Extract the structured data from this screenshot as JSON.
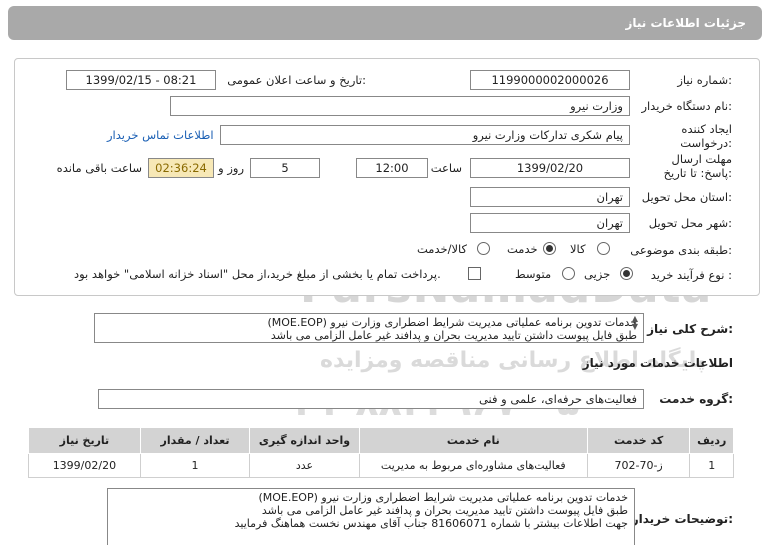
{
  "header": {
    "title": "جزئیات اطلاعات نیاز"
  },
  "form": {
    "need_number_label": "شماره نیاز:",
    "need_number": "1199000002000026",
    "announce_label": "تاریخ و ساعت اعلان عمومی:",
    "announce_value": "1399/02/15 - 08:21",
    "buyer_label": "نام دستگاه خریدار:",
    "buyer_value": "وزارت نیرو",
    "creator_label": "ایجاد کننده درخواست:",
    "creator_value": "پیام شکری تدارکات وزارت نیرو",
    "contact_link": "اطلاعات تماس خریدار",
    "deadline_label": "مهلت ارسال پاسخ: تا تاریخ:",
    "deadline_date": "1399/02/20",
    "time_label": "ساعت",
    "deadline_time": "12:00",
    "days_count": "5",
    "days_label": "روز و",
    "remaining_time": "02:36:24",
    "remaining_label": "ساعت باقی مانده",
    "province_label": "استان محل تحویل:",
    "province_value": "تهران",
    "city_label": "شهر محل تحویل:",
    "city_value": "تهران",
    "category_label": "طبقه بندی موضوعی:",
    "category_options": [
      "کالا",
      "خدمت",
      "کالا/خدمت"
    ],
    "category_selected": "خدمت",
    "process_label": "نوع فرآیند خرید :",
    "process_options": [
      "جزیی",
      "متوسط"
    ],
    "process_selected": "جزیی",
    "payment_note": "پرداخت تمام یا بخشی از مبلغ خرید،از محل \"اسناد خزانه اسلامی\" خواهد بود."
  },
  "summary": {
    "label": "شرح کلی نیاز:",
    "line1": "خدمات تدوین برنامه عملیاتی مدیریت شرایط اضطراری وزارت نیرو (MOE.EOP)",
    "line2": "طبق فایل پیوست داشتن تایید مدیریت بحران و پدافند غیر عامل الزامی می باشد"
  },
  "services": {
    "title": "اطلاعات خدمات مورد نیاز",
    "group_label": "گروه خدمت:",
    "group_value": "فعالیت‌های حرفه‌ای، علمی و فنی",
    "columns": [
      "ردیف",
      "کد خدمت",
      "نام خدمت",
      "واحد اندازه گیری",
      "تعداد / مقدار",
      "تاریخ نیاز"
    ],
    "rows": [
      [
        "1",
        "ز-70-702",
        "فعالیت‌های مشاوره‌ای مربوط به مدیریت",
        "عدد",
        "1",
        "1399/02/20"
      ]
    ]
  },
  "buyer_notes": {
    "label": "توضیحات خریدار:",
    "line1": "خدمات تدوین برنامه عملیاتی مدیریت شرایط اضطراری وزارت نیرو (MOE.EOP)",
    "line2": "طبق فایل پیوست داشتن تایید مدیریت بحران و پدافند غیر عامل الزامی می باشد",
    "line3": "جهت اطلاعات بیشتر با شماره 81606071 جناب آقای مهندس نخست هماهنگ فرمایید"
  },
  "watermark": {
    "brand": "ParsNamadData",
    "line1": "پایگاه اطلاع رسانی مناقصه ومزایده",
    "phone": "۰۲۱-۸۸۳۴۹۶۷۰-۵"
  },
  "colors": {
    "header_bg": "#a9a9a9",
    "link": "#1a5fb4",
    "timer_bg": "#f7e8b6",
    "table_header_bg": "#d3d3d3"
  }
}
